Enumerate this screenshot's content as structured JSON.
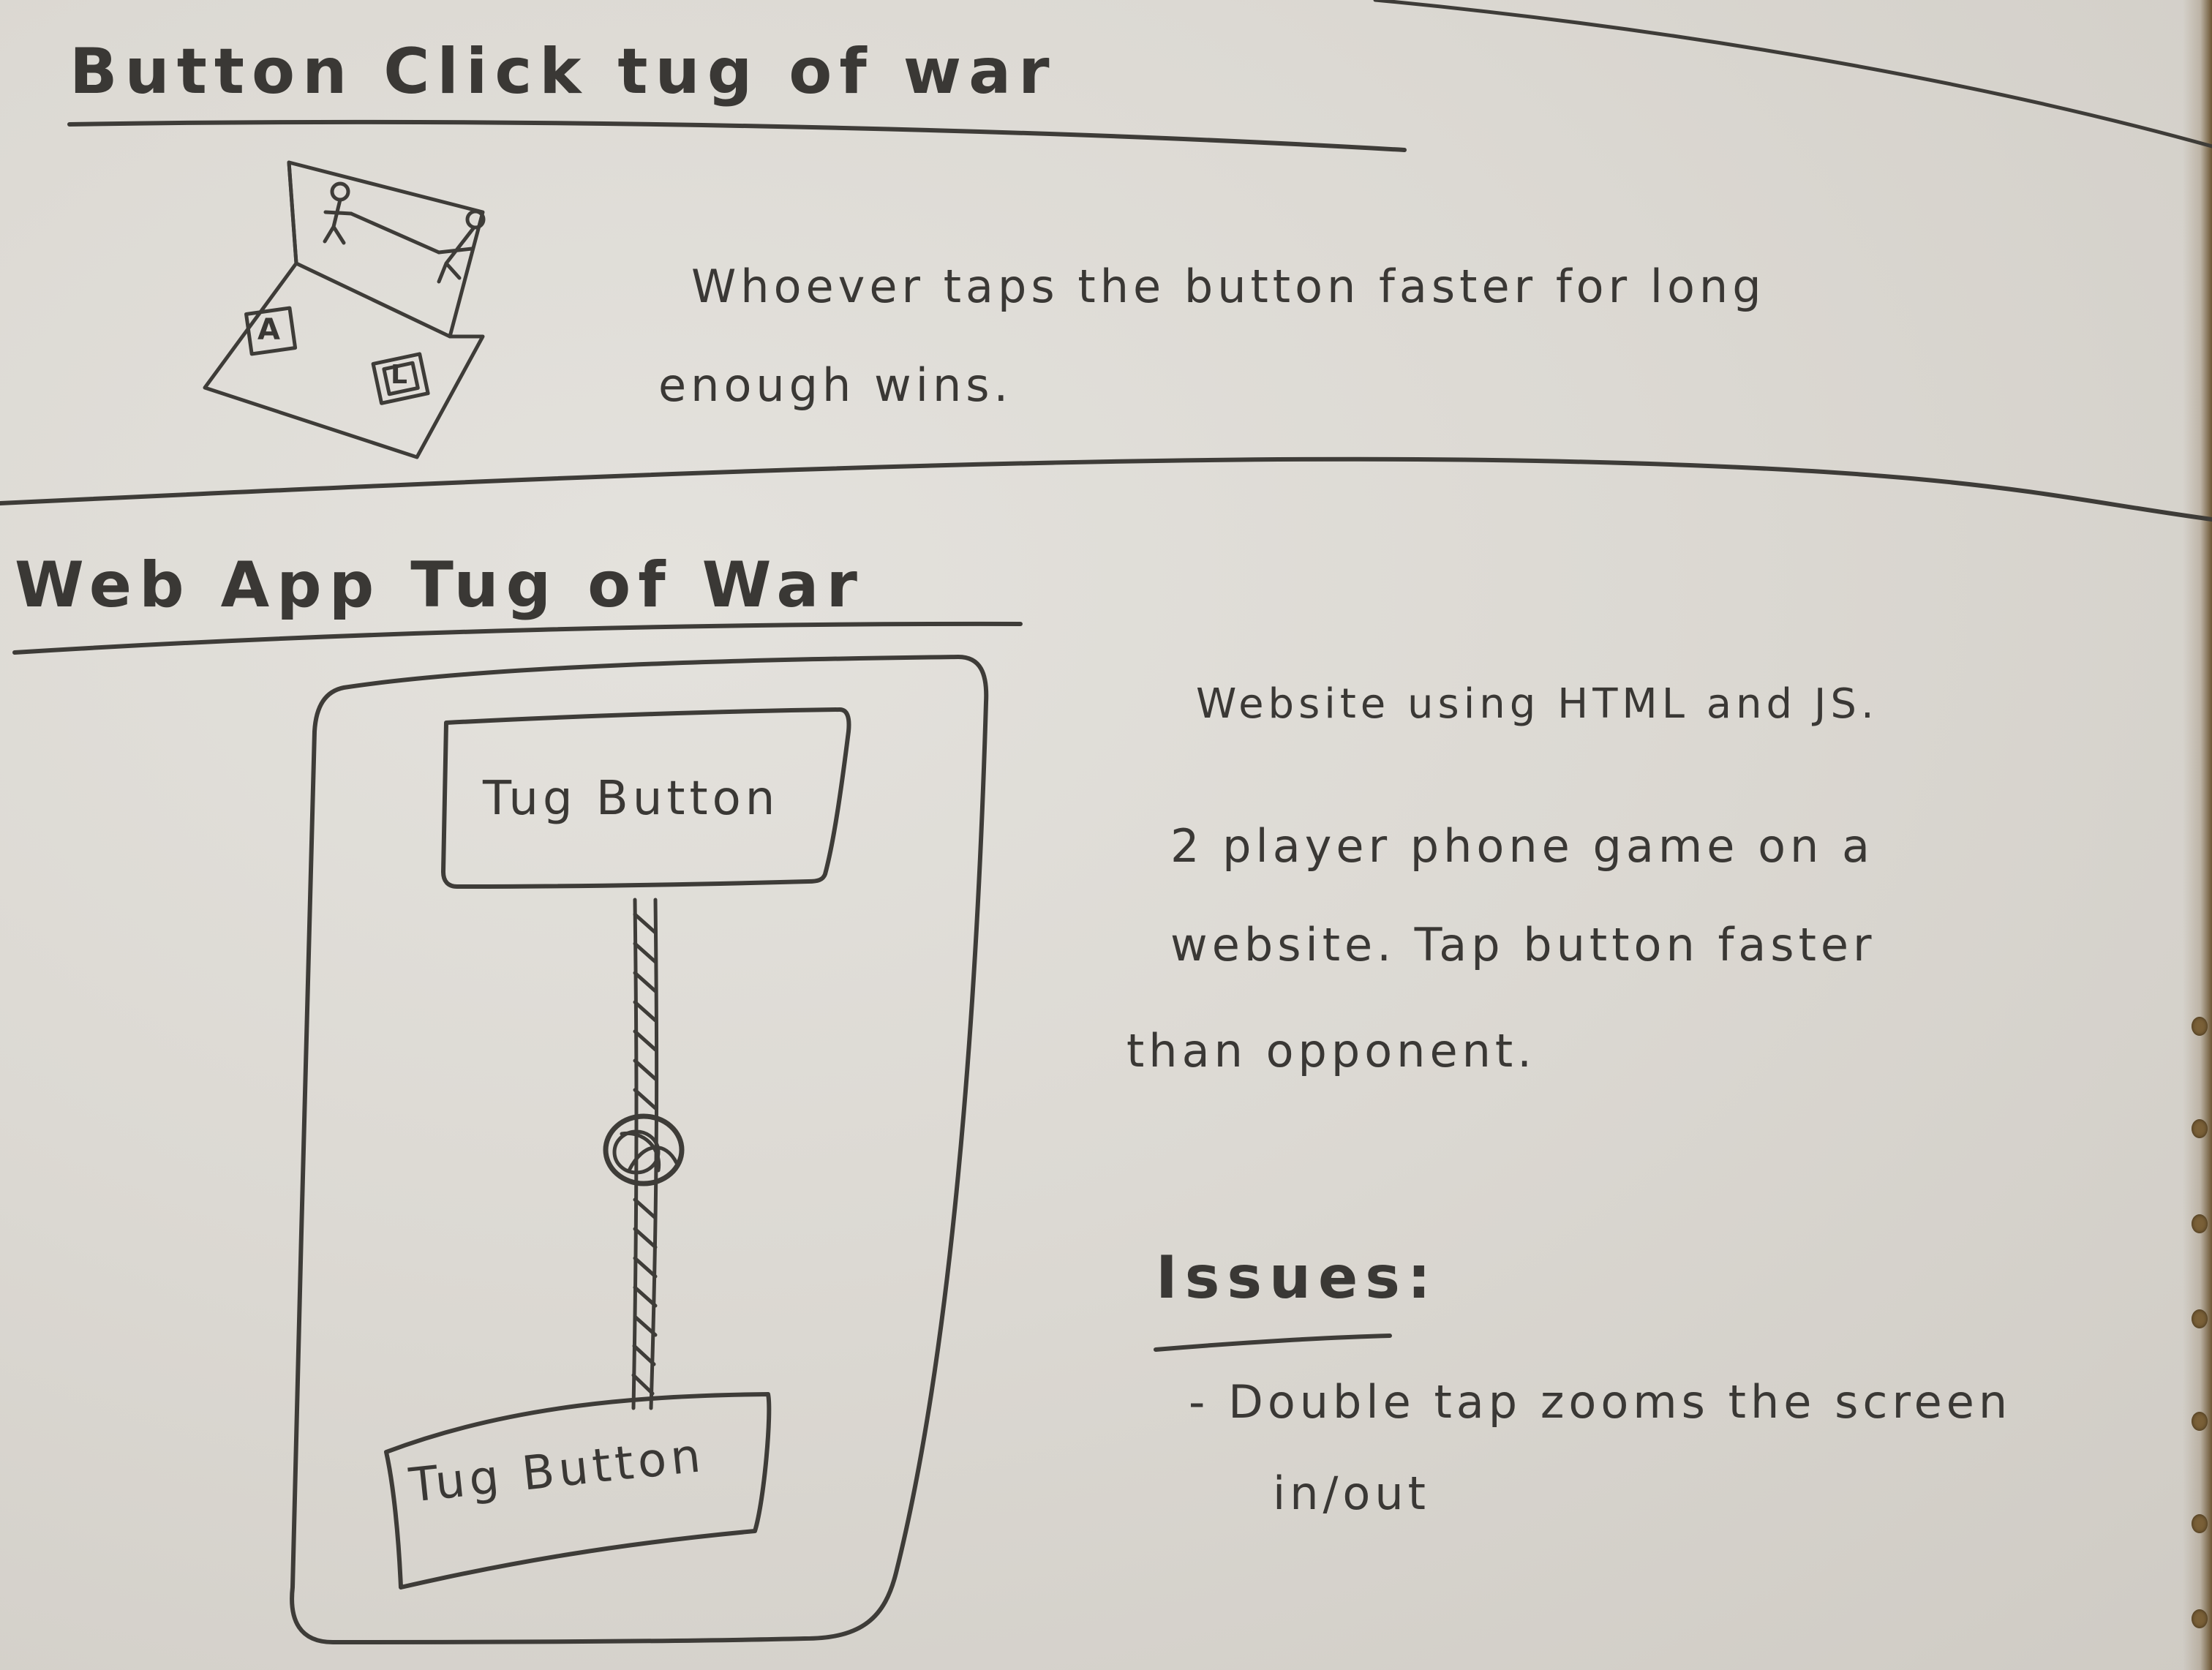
{
  "section1": {
    "title": "Button Click tug of war",
    "description_line1": "Whoever taps the button faster for long",
    "description_line2": "enough wins.",
    "sketch": {
      "button_a_label": "A",
      "button_l_label": "L"
    }
  },
  "section2": {
    "title": "Web App Tug of War",
    "phone": {
      "top_button_label": "Tug Button",
      "bottom_button_label": "Tug Button"
    },
    "notes": {
      "line1": "Website using HTML and JS.",
      "line2": "2 player phone game on a",
      "line3": "website. Tap button faster",
      "line4": "than opponent."
    },
    "issues": {
      "heading": "Issues:",
      "item1_line1": "- Double tap zooms the screen",
      "item1_line2": "in/out"
    }
  },
  "colors": {
    "paper": "#dcd9d3",
    "pencil": "#3a3835",
    "torn_edge": "#6b5533"
  }
}
